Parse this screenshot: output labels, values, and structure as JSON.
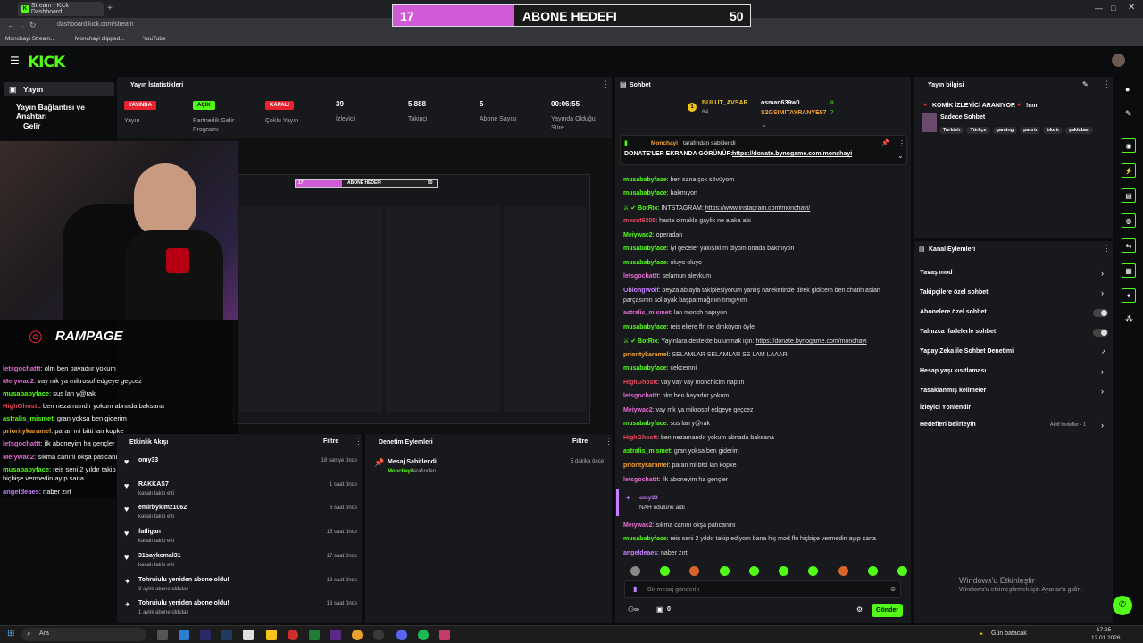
{
  "browser": {
    "tab_title": "Stream - Kick Dashboard",
    "url": "dashboard.kick.com/stream",
    "bookmarks": [
      "Monchayi Stream...",
      "Monchayi clipped...",
      "YouTube"
    ]
  },
  "goal_overlay": {
    "current": "17",
    "label": "ABONE HEDEFI",
    "target": "50",
    "progress": 0.34
  },
  "header": {
    "logo": "KICK"
  },
  "sidebar": {
    "items": [
      "Yayın",
      "Yayın Bağlantısı ve Anahtarı",
      "Gelir"
    ]
  },
  "stream_stats": {
    "title": "Yayın İstatistikleri",
    "stats": [
      {
        "value": "YAYINDA",
        "label": "Yayın",
        "type": "badge",
        "color": "#e8232f"
      },
      {
        "value": "AÇIK",
        "label": "Partnerlik Gelir Programı",
        "type": "badge",
        "color": "#53fc18"
      },
      {
        "value": "KAPALI",
        "label": "Çoklu Yayın",
        "type": "badge",
        "color": "#e8232f"
      },
      {
        "value": "39",
        "label": "İzleyici"
      },
      {
        "value": "5.888",
        "label": "Takipçi"
      },
      {
        "value": "5",
        "label": "Abone Sayısı"
      },
      {
        "value": "00:06:55",
        "label": "Yayında Olduğu Süre"
      }
    ]
  },
  "overlay": {
    "brand": "RAMPAGE",
    "preview_goal": {
      "current": "17",
      "label": "ABONE HEDEFI",
      "target": "50"
    },
    "chat": [
      {
        "user": "letsgochattt",
        "text": "olm ben bayadıır yokum",
        "color": "pk"
      },
      {
        "user": "Meiywac2",
        "text": "vay mk ya mikrosof edgeye geçcez",
        "color": "pk"
      },
      {
        "user": "musababyface",
        "text": "sus lan y@rak",
        "color": "g"
      },
      {
        "user": "HighGhostt",
        "text": "ben nezamandır yokum abnada baksana",
        "color": "r"
      },
      {
        "user": "astralis_mismet",
        "text": "gran yoksa ben giderim",
        "color": "g"
      },
      {
        "user": "prioritykaramel",
        "text": "paran mi bitti lan kopke",
        "color": "o"
      },
      {
        "user": "letsgochattt",
        "text": "ilk aboneyim ha gençler",
        "color": "pk"
      },
      {
        "user": "Meiywac2",
        "text": "sıkma canını okşa patıcanını",
        "color": "pk"
      },
      {
        "user": "musababyface",
        "text": "reis seni 2 yıldır takip ediyom bana hiç mod fln hiçbişe vermedin ayıp sana",
        "color": "g"
      },
      {
        "user": "angeldeaes",
        "text": "naber zırt",
        "color": "p"
      }
    ]
  },
  "activity": {
    "title": "Etkinlik Akışı",
    "filter": "Filtre",
    "events": [
      {
        "name": "omy33",
        "sub": "",
        "time": "18 saniye önce",
        "icon": "heart-icon"
      },
      {
        "name": "RAKKAS7",
        "sub": "kanalı takip etti",
        "time": "1 saat önce",
        "icon": "heart-icon"
      },
      {
        "name": "emirbykimz1062",
        "sub": "kanalı takip etti",
        "time": "6 saat önce",
        "icon": "heart-icon"
      },
      {
        "name": "fatligan",
        "sub": "kanalı takip etti",
        "time": "15 saat önce",
        "icon": "heart-icon"
      },
      {
        "name": "31baykemal31",
        "sub": "kanalı takip etti",
        "time": "17 saat önce",
        "icon": "heart-icon"
      },
      {
        "name": "Tohruiulu yeniden abone oldu!",
        "sub": "3 aylık abone oldular",
        "time": "18 saat önce",
        "icon": "star-icon"
      },
      {
        "name": "Tohruiulu yeniden abone oldu!",
        "sub": "1 aylık abone oldular",
        "time": "18 saat önce",
        "icon": "star-icon"
      }
    ]
  },
  "moderation": {
    "title": "Denetim Eylemleri",
    "filter": "Filtre",
    "items": [
      {
        "title": "Mesaj Sabitlendi",
        "user": "Monchayi",
        "sub": "tarafından",
        "time": "5 dakika önce"
      }
    ]
  },
  "chat": {
    "title": "Sohbet",
    "top_gifters": [
      {
        "name": "BULUT_AVSAR",
        "count": "64",
        "rank": "1"
      },
      {
        "name": "osman639w0",
        "count": "8"
      },
      {
        "name": "S2GSIMITAYRANYE97",
        "count": "7"
      }
    ],
    "pinned": {
      "by": "Monchayi",
      "by_suffix": "tarafından sabitlendi",
      "text": "DONATE'LER EKRANDA GÖRÜNÜR:",
      "link": "https://donate.bynogame.com/monchayi"
    },
    "messages": [
      {
        "user": "musababyface",
        "text": "ben sana çok sövüyom",
        "color": "g"
      },
      {
        "user": "musababyface",
        "text": "bakmıyon",
        "color": "g"
      },
      {
        "user": "BotRix",
        "text": "INTSTAGRAM:",
        "link": "https://www.instagram.com/monchayi/",
        "color": "g"
      },
      {
        "user": "mesut6305",
        "text": "hasta olmakla gaylik ne alaka abi",
        "color": "r"
      },
      {
        "user": "Meiywac2",
        "text": "operadan",
        "color": "g"
      },
      {
        "user": "musababyface",
        "text": "iyi geceler yakışıklım diyom onada bakmıyon",
        "color": "g"
      },
      {
        "user": "musababyface",
        "text": "oluyo oluyo",
        "color": "g"
      },
      {
        "user": "letsgochattt",
        "text": "selamun aleykum",
        "color": "pk"
      },
      {
        "user": "OblongWolf",
        "text": "beyza ablayla takipleşiyorum yanlış hareketinde direk gidicem ben chatin aslan",
        "text2": "parçasının sol ayak başparmağının tırngıyım",
        "color": "p"
      },
      {
        "user": "astralis_mismet",
        "text": "lan monch napıyon",
        "color": "pk"
      },
      {
        "user": "musababyface",
        "text": "reis eliere fln ne dmküyon öyle",
        "color": "g"
      },
      {
        "user": "BotRix",
        "text": "Yayınlara destekte bulunmak için:",
        "link": "https://donate.bynogame.com/monchayi",
        "color": "g"
      },
      {
        "user": "prioritykaramel",
        "text": "SELAMLAR SELAMLAR SE LAM LAAAR",
        "color": "o"
      },
      {
        "user": "musababyface",
        "text": "çekcemni",
        "color": "g"
      },
      {
        "user": "HighGhostt",
        "text": "vay vay vay monchicim naptın",
        "color": "r"
      },
      {
        "user": "letsgochattt",
        "text": "olm ben bayadıır yokum",
        "color": "pk"
      },
      {
        "user": "Meiywac2",
        "text": "vay mk ya mikrosof edgeye geçcez",
        "color": "pk"
      },
      {
        "user": "musababyface",
        "text": "sus lan y@rak",
        "color": "g"
      },
      {
        "user": "HighGhostt",
        "text": "ben nezamandır yokum abnada baksana",
        "color": "r"
      },
      {
        "user": "astralis_mismet",
        "text": "gran yoksa ben giderim",
        "color": "g"
      },
      {
        "user": "prioritykaramel",
        "text": "paran mi bitti lan kopke",
        "color": "o"
      },
      {
        "user": "letsgochattt",
        "text": "ilk aboneyim ha gençler",
        "color": "pk"
      }
    ],
    "redeem": {
      "user": "omy33",
      "text": "NAH ödülünü aldı"
    },
    "after": [
      {
        "user": "Meiywac2",
        "text": "sıkma canını okşa patıcanını",
        "color": "pk"
      },
      {
        "user": "musababyface",
        "text": "reis seni 2 yıldır takip ediyom bana hiç mod fln hiçbişe vermedin ayıp sana",
        "color": "g"
      },
      {
        "user": "angeldeaes",
        "text": "naber zırt",
        "color": "p"
      }
    ],
    "placeholder": "Bir mesaj gönderin",
    "send": "Gönder",
    "points": "0"
  },
  "stream_info": {
    "title": "Yayın bilgisi",
    "stream_title": "KOMİK İZLEYİCİ ARANIYOR",
    "stream_title_suffix": "!cm",
    "category": "Sadece Sohbet",
    "tags": [
      "Turkish",
      "Türkçe",
      "gaming",
      "patırtı",
      "tıkırtı",
      "şaklaban"
    ]
  },
  "channel_actions": {
    "title": "Kanal Eylemleri",
    "items": [
      {
        "label": "Yavaş mod",
        "control": "chevron"
      },
      {
        "label": "Takipçilere özel sohbet",
        "control": "chevron"
      },
      {
        "label": "Abonelere özel sohbet",
        "control": "toggle"
      },
      {
        "label": "Yalnızca ifadelerle sohbet",
        "control": "toggle"
      },
      {
        "label": "Yapay Zeka ile Sohbet Denetimi",
        "control": "external"
      },
      {
        "label": "Hesap yaşı kısıtlaması",
        "control": "chevron"
      },
      {
        "label": "Yasaklanmış kelimeler",
        "control": "chevron"
      },
      {
        "label": "İzleyici Yönlendir",
        "control": "none"
      },
      {
        "label": "Hedefleri belirleyin",
        "control": "chevron",
        "badge": "Aktif hedefler - 1"
      }
    ]
  },
  "windows_watermark": {
    "line1": "Windows'u Etkinleştir",
    "line2": "Windows'u etkinleştirmek için Ayarlar'a gidin."
  },
  "taskbar": {
    "search": "Ara",
    "weather": "Gün batacak",
    "time": "17:25",
    "date": "12.01.2026"
  }
}
